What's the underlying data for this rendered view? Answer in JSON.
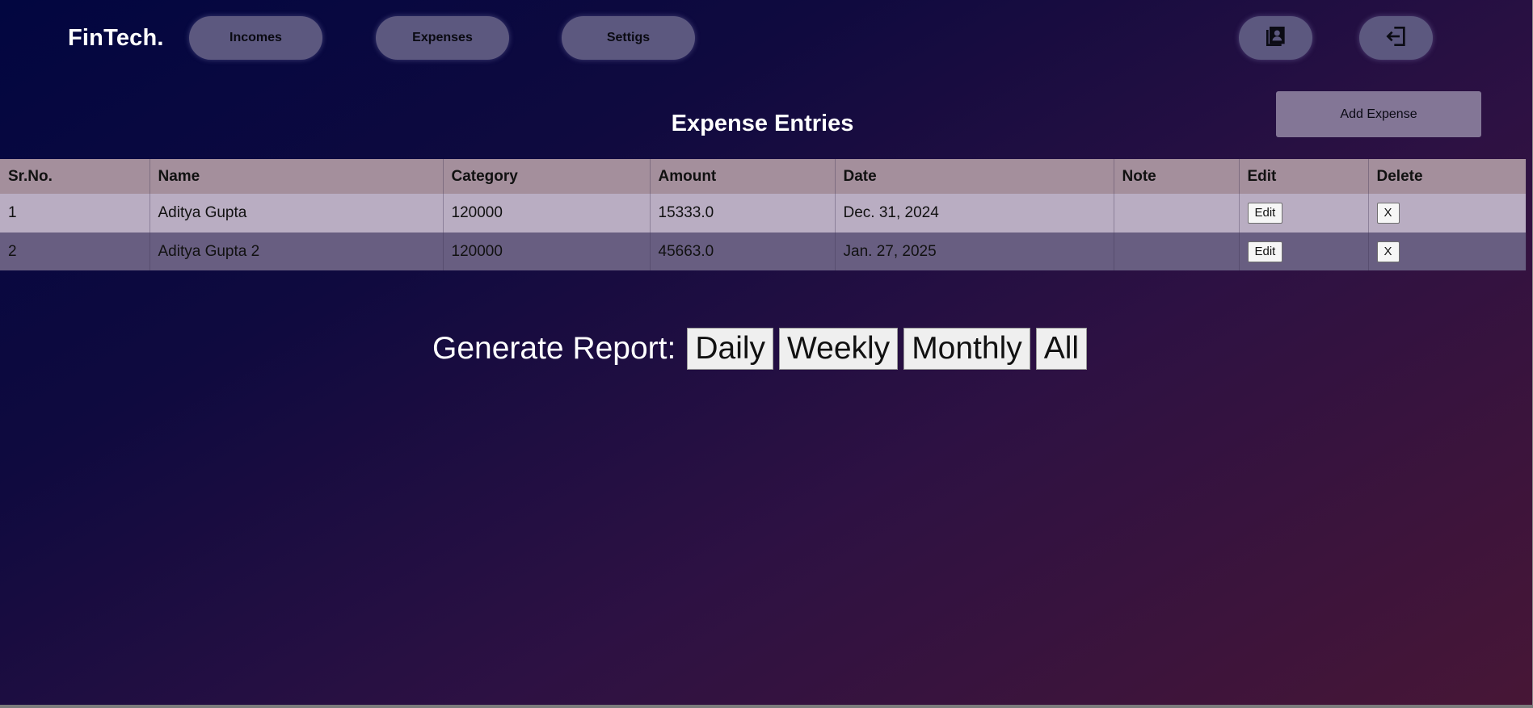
{
  "header": {
    "brand": "FinTech.",
    "nav": [
      {
        "label": "Incomes"
      },
      {
        "label": "Expenses"
      },
      {
        "label": "Settigs"
      }
    ],
    "icons": [
      "contacts-book-icon",
      "logout-icon"
    ]
  },
  "main": {
    "title": "Expense Entries",
    "add_button": "Add Expense",
    "table": {
      "columns": [
        "Sr.No.",
        "Name",
        "Category",
        "Amount",
        "Date",
        "Note",
        "Edit",
        "Delete"
      ],
      "rows": [
        {
          "sr": "1",
          "name": "Aditya Gupta",
          "category": "120000",
          "amount": "15333.0",
          "date": "Dec. 31, 2024",
          "note": "",
          "edit": "Edit",
          "delete": "X"
        },
        {
          "sr": "2",
          "name": "Aditya Gupta 2",
          "category": "120000",
          "amount": "45663.0",
          "date": "Jan. 27, 2025",
          "note": "",
          "edit": "Edit",
          "delete": "X"
        }
      ]
    }
  },
  "report": {
    "label": "Generate Report:",
    "buttons": [
      "Daily",
      "Weekly",
      "Monthly",
      "All"
    ]
  },
  "colors": {
    "nav_button": "#5c587f",
    "add_button": "#837696",
    "table_header": "#a48f9c",
    "row_odd": "#b9adc2",
    "row_even": "#685e81"
  }
}
